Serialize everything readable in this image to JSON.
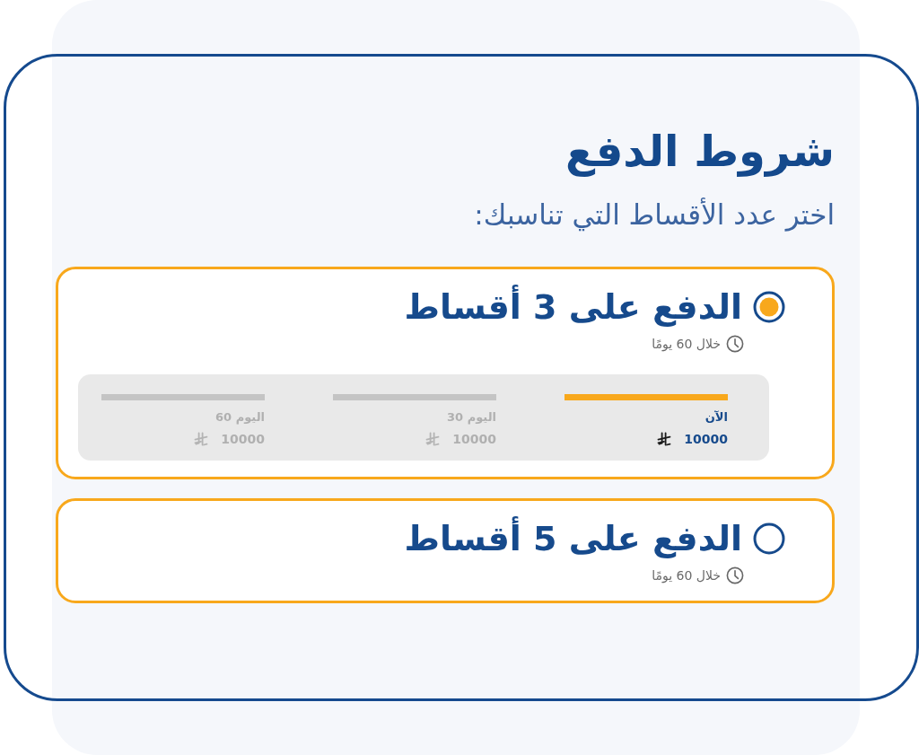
{
  "title": "شروط الدفع",
  "subtitle": "اختر عدد الأقساط التي تناسبك:",
  "options": [
    {
      "title": "الدفع على 3 أقساط",
      "selected": true,
      "duration": "خلال 60 يومًا",
      "installments": [
        {
          "label": "الآن",
          "amount": "10000",
          "current": true
        },
        {
          "label": "اليوم 30",
          "amount": "10000",
          "current": false
        },
        {
          "label": "اليوم 60",
          "amount": "10000",
          "current": false
        }
      ]
    },
    {
      "title": "الدفع على 5 أقساط",
      "selected": false,
      "duration": "خلال 60 يومًا"
    }
  ]
}
